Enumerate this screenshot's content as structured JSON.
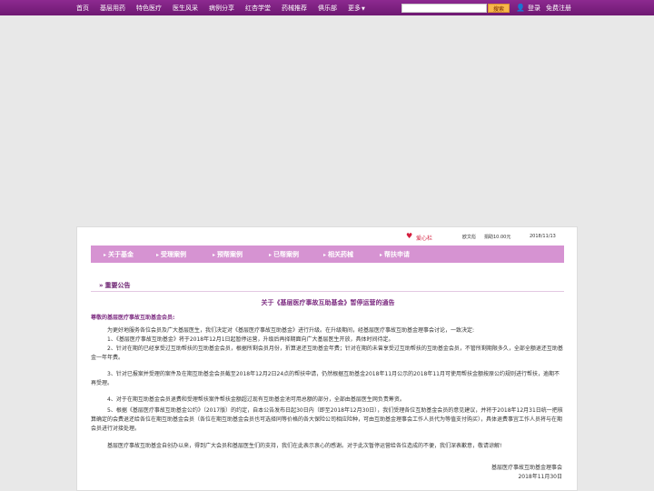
{
  "nav": {
    "items": [
      "首页",
      "基层用药",
      "特色医疗",
      "医生风采",
      "病例分享",
      "红杏学堂",
      "药械推荐",
      "俱乐部",
      "更多"
    ],
    "search_button": "搜索",
    "login": "登录",
    "register": "免费注册"
  },
  "meta": {
    "love_label": "爱心栏",
    "author": "欧文彪",
    "donation": "捐助10.00元",
    "date": "2018/11/13"
  },
  "tabs": [
    "关于基金",
    "受理案例",
    "预帮案例",
    "已帮案例",
    "相关药械",
    "帮扶申请"
  ],
  "article": {
    "section": "重要公告",
    "title": "关于《基层医疗事故互助基金》暂停运营的通告",
    "greeting": "尊敬的基层医疗事故互助基金会员:",
    "paragraphs": [
      "为更好地服务各位会员及广大基层医生，我们决定对《基层医疗事故互助基金》进行升级。在升级期间，经基层医疗事故互助基金理事会讨论，一致决定:",
      "1、《基层医疗事故互助基金》将于2018年12月1日起暂停运营，升级后再择期面向广大基层医生开放，具体时间待定。",
      "2、针对在期的已经享受过互助帮扶的互助基金会员，根据所剩会员月份，折算退还互助基金年费；针对在期的未曾享受过互助帮扶的互助基金会员，不管所剩期限多久，全部全额退还互助基金一年年费。",
      "3、针对已报案并受理的案件及在期互助基金会员截至2018年12月2日24点的帮扶申请，仍然根据互助基金2018年11月公示的2018年11月可使用帮扶金额按原公约规则进行帮扶，逾期不再受理。",
      "4、对于在期互助基金会员退费和受理帮扶案件帮扶金额超过现有互助基金池可用总额的部分，全部由基层医生网负责筹资。",
      "5、根据《基层医疗事故互助基金公约》（2017版）的约定，自本公告发布日起30日内（即至2018年12月30日），我们受理各位互助基金会员的意见建议，并将于2018年12月31日统一把核算确定的会费退还给各位在期互助基金会员（各位在期互助基金会员也可选择同等价格的各大保险公司相应险种，可由互助基金理事会工作人员代为等值支付购买），具体退费事宜工作人员将与在期会员进行对接处理。",
      "基层医疗事故互助基金自创办以来，得到广大会员和基层医生们的支持，我们在此表示衷心的感谢。对于此次暂停运营给各位造成的不便，我们深表歉意，敬请谅解!"
    ],
    "signature": "基层医疗事故互助基金理事会",
    "sign_date": "2018年11月30日"
  }
}
